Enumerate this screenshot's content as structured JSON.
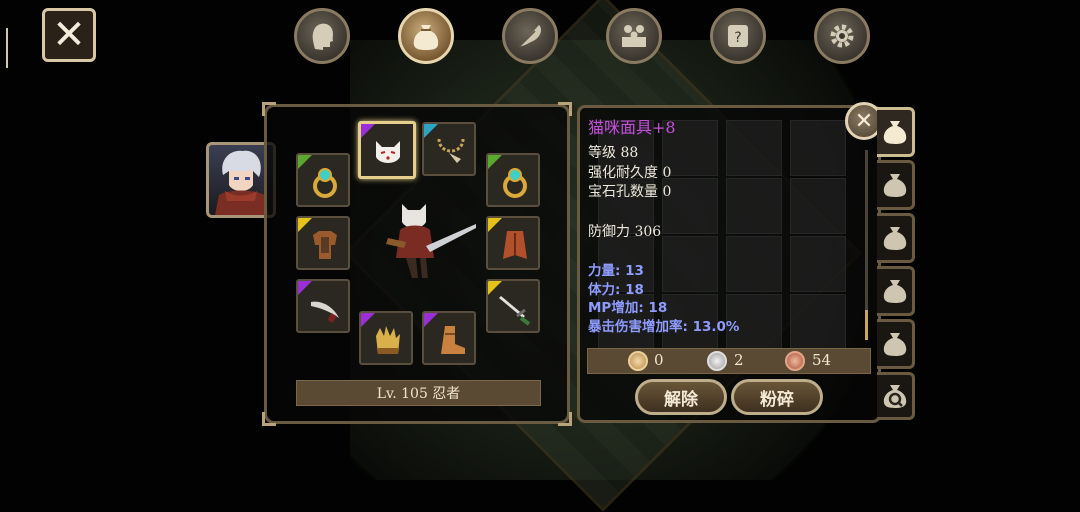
{
  "colors": {
    "rarity_epic": "#9a2fd6",
    "rarity_rare": "#2aa6c4",
    "rarity_legend": "#e4c21a",
    "rarity_uncommon": "#5aa830",
    "stat_text": "#8f9cff",
    "item_name": "#c64fe0"
  },
  "top_tabs": [
    {
      "name": "character",
      "icon": "head-icon"
    },
    {
      "name": "inventory",
      "icon": "bag-icon",
      "active": true
    },
    {
      "name": "skills",
      "icon": "feather-icon"
    },
    {
      "name": "party",
      "icon": "people-icon"
    },
    {
      "name": "quests",
      "icon": "scroll-icon"
    },
    {
      "name": "settings",
      "icon": "gear-icon"
    }
  ],
  "character": {
    "level_label": "Lv. 105 忍者"
  },
  "equipment_slots": [
    {
      "slot": "ring-left",
      "icon": "ring-icon",
      "rarity": "uncommon"
    },
    {
      "slot": "mask",
      "icon": "cat-mask-icon",
      "rarity": "epic",
      "selected": true
    },
    {
      "slot": "necklace",
      "icon": "necklace-icon",
      "rarity": "rare"
    },
    {
      "slot": "ring-right",
      "icon": "ring-icon",
      "rarity": "uncommon"
    },
    {
      "slot": "armor",
      "icon": "armor-icon",
      "rarity": "legend"
    },
    {
      "slot": "cape",
      "icon": "cape-icon",
      "rarity": "legend"
    },
    {
      "slot": "offhand",
      "icon": "dagger-icon",
      "rarity": "epic"
    },
    {
      "slot": "gloves",
      "icon": "glove-icon",
      "rarity": "epic"
    },
    {
      "slot": "boots",
      "icon": "boot-icon",
      "rarity": "epic"
    },
    {
      "slot": "weapon",
      "icon": "sword-icon",
      "rarity": "legend"
    }
  ],
  "item_detail": {
    "name": "猫咪面具+8",
    "level": "等级 88",
    "durability": "强化耐久度 0",
    "sockets": "宝石孔数量 0",
    "defense": "防御力 306",
    "stats": [
      "力量: 13",
      "体力: 18",
      "MP增加: 18",
      "暴击伤害增加率: 13.0%"
    ]
  },
  "currency": {
    "gold": "0",
    "silver": "2",
    "bronze": "54"
  },
  "buttons": {
    "unequip": "解除",
    "smash": "粉碎"
  },
  "bag_tabs": [
    "bag-1",
    "bag-2",
    "bag-3",
    "bag-4",
    "bag-5",
    "search"
  ]
}
